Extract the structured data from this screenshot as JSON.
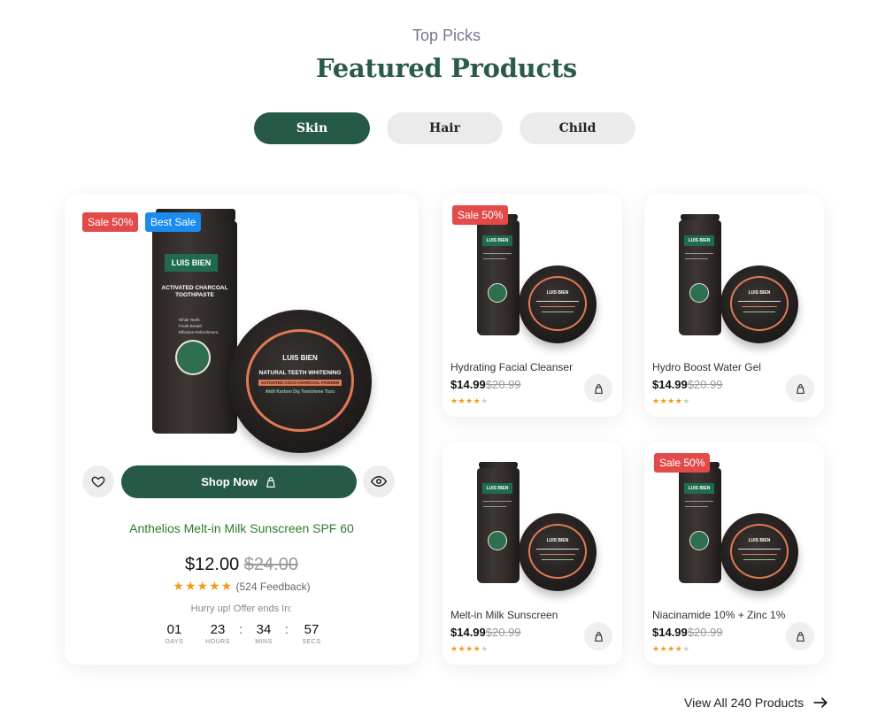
{
  "header": {
    "eyebrow": "Top Picks",
    "title": "Featured Products"
  },
  "tabs": [
    {
      "label": "Skin",
      "active": true
    },
    {
      "label": "Hair",
      "active": false
    },
    {
      "label": "Child",
      "active": false
    }
  ],
  "product_art": {
    "brand": "LUIS BIEN",
    "tube_text": "ACTIVATED CHARCOAL TOOTHPASTE",
    "jar_title": "NATURAL TEETH WHITENING",
    "jar_band": "ACTIVATED COCO CHARCOAL POWDER",
    "jar_sub": "Aktif Karbon Diş Temizleme Tozu",
    "tube_bullets": [
      "White Teeth",
      "Fresh Breath",
      "Effective Refreshment"
    ]
  },
  "featured": {
    "badges": [
      "Sale 50%",
      "Best Sale"
    ],
    "shop_label": "Shop Now",
    "name": "Anthelios Melt-in Milk Sunscreen SPF 60",
    "price": "$12.00",
    "old_price": "$24.00",
    "stars": "★★★★★",
    "feedback": "(524 Feedback)",
    "hurry": "Hurry up! Offer ends In:",
    "countdown": [
      {
        "value": "01",
        "label": "DAYS"
      },
      {
        "value": "23",
        "label": "HOURS"
      },
      {
        "value": "34",
        "label": "MINS"
      },
      {
        "value": "57",
        "label": "SECS"
      }
    ],
    "rating": 5
  },
  "products": [
    {
      "name": "Hydrating Facial Cleanser",
      "price": "$14.99",
      "old_price": "$20.99",
      "badge": "Sale 50%",
      "stars_on": "★★★★",
      "stars_off": "★",
      "rating": 4
    },
    {
      "name": "Hydro Boost Water Gel",
      "price": "$14.99",
      "old_price": "$20.99",
      "badge": "",
      "stars_on": "★★★★",
      "stars_off": "★",
      "rating": 4
    },
    {
      "name": "Melt-in Milk Sunscreen",
      "price": "$14.99",
      "old_price": "$20.99",
      "badge": "",
      "stars_on": "★★★★",
      "stars_off": "★",
      "rating": 4
    },
    {
      "name": "Niacinamide 10% + Zinc 1%",
      "price": "$14.99",
      "old_price": "$20.99",
      "badge": "Sale 50%",
      "stars_on": "★★★★",
      "stars_off": "★",
      "rating": 4
    }
  ],
  "view_all": "View All 240 Products",
  "icons": [
    "heart-icon",
    "bag-icon",
    "eye-icon",
    "arrow-right-icon"
  ],
  "colors": {
    "brand_green": "#265a47",
    "sale_red": "#e34a4a",
    "best_blue": "#1a8cf0",
    "star_orange": "#f39b1b"
  }
}
